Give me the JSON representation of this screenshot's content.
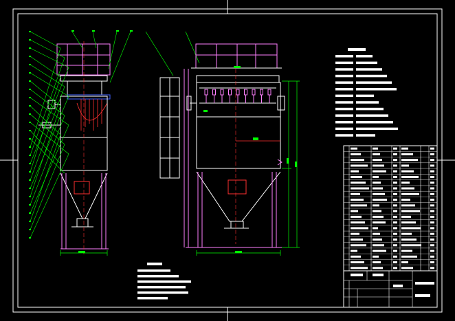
{
  "drawing": {
    "background": "#000000",
    "colors": {
      "frame": "#ffffff",
      "structure": "#ffffff",
      "leaders": "#00ff00",
      "dimension": "#00ff00",
      "supports": "#ff80ff",
      "centerline": "#ff3030",
      "accent_blue": "#4060ff",
      "accent_cyan": "#00e0ff",
      "text": "#ffffff"
    },
    "views": [
      "side-elevation",
      "front-elevation"
    ],
    "leader_count": 26,
    "spec_lines": 13,
    "note_lines": 6,
    "parts_table_rows": 22
  }
}
